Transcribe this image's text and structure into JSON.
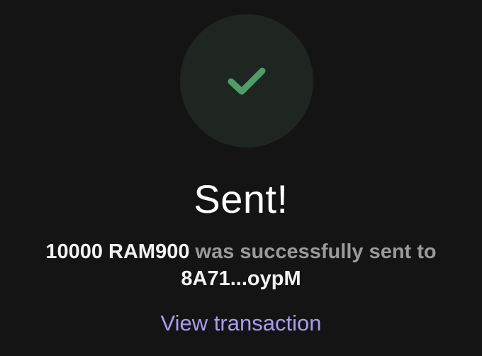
{
  "status": {
    "title": "Sent!",
    "icon": "checkmark-icon",
    "icon_color": "#4f9e6a",
    "circle_color": "#1f2622"
  },
  "message": {
    "amount": "10000 RAM900",
    "connector": " was successfully sent to",
    "recipient": "8A71...oypM"
  },
  "actions": {
    "view_transaction_label": "View transaction",
    "link_color": "#a89cf0"
  }
}
